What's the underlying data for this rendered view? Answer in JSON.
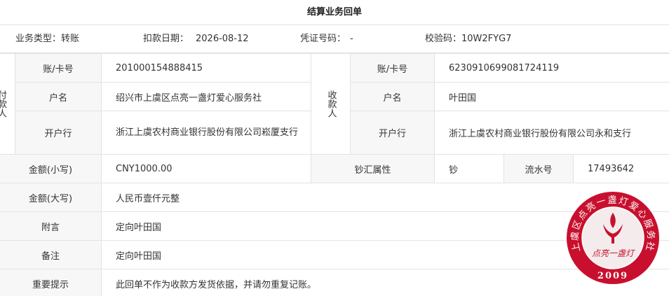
{
  "title": "结算业务回单",
  "info": {
    "type_label": "业务类型：",
    "type_value": "转账",
    "date_label": "扣款日期：",
    "date_value": "2026-08-12",
    "voucher_label": "凭证号码：",
    "voucher_value": "-",
    "check_label": "校验码：",
    "check_value": "10W2FYG7"
  },
  "payer": {
    "side_label": "付款人",
    "account_label": "账/卡号",
    "account_value": "201000154888415",
    "name_label": "户名",
    "name_value": "绍兴市上虞区点亮一盏灯爱心服务社",
    "bank_label": "开户行",
    "bank_value": "浙江上虞农村商业银行股份有限公司崧厦支行"
  },
  "payee": {
    "side_label": "收款人",
    "account_label": "账/卡号",
    "account_value": "6230910699081724119",
    "name_label": "户名",
    "name_value": "叶田国",
    "bank_label": "开户行",
    "bank_value": "浙江上虞农村商业银行股份有限公司永和支行"
  },
  "amount": {
    "small_label": "金额(小写)",
    "small_value": "CNY1000.00",
    "cash_label": "钞汇属性",
    "cash_value": "钞",
    "serial_label": "流水号",
    "serial_value": "17493642",
    "big_label": "金额(大写)",
    "big_value": "人民币壹仟元整"
  },
  "postscript": {
    "label": "附言",
    "value": "定向叶田国"
  },
  "remark": {
    "label": "备注",
    "value": "定向叶田国"
  },
  "notice": {
    "label": "重要提示",
    "value": "此回单不作为收款方发货依据，并请勿重复记账。"
  },
  "seal": {
    "ring_text": "上虞区点亮一盏灯爱心服务社",
    "center_text": "点亮一盏灯",
    "year": "2009",
    "color": "#c8102e"
  }
}
